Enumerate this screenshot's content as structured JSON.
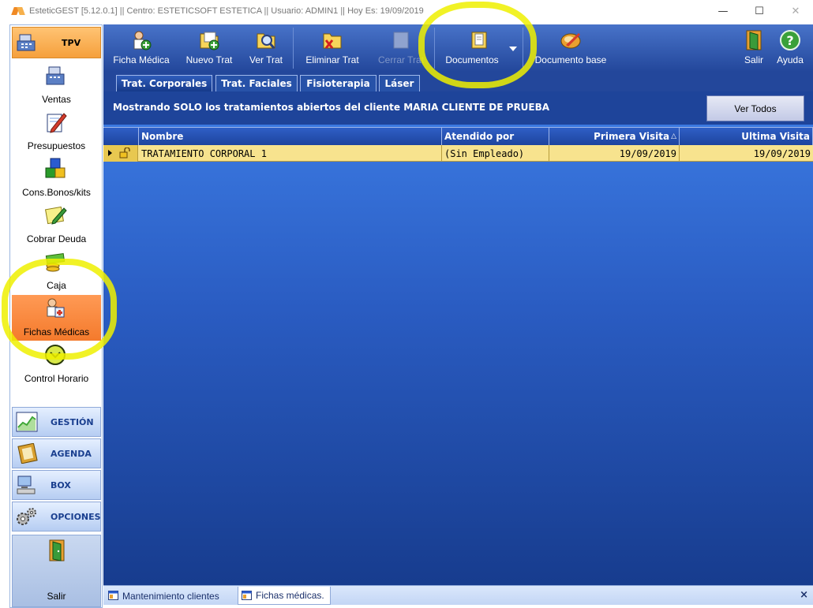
{
  "window": {
    "title": "EsteticGEST [5.12.0.1] || Centro: ESTETICSOFT ESTETICA  || Usuario: ADMIN1 || Hoy Es: 19/09/2019",
    "min_glyph": "—",
    "max_glyph": "☐",
    "close_glyph": "✕"
  },
  "sidebar": {
    "header_label": "TPV",
    "items": [
      {
        "label": "Ventas",
        "icon": "cash-register-icon"
      },
      {
        "label": "Presupuestos",
        "icon": "pencil-document-icon"
      },
      {
        "label": "Cons.Bonos/kits",
        "icon": "blocks-icon"
      },
      {
        "label": "Cobrar Deuda",
        "icon": "note-pencil-icon"
      },
      {
        "label": "Caja",
        "icon": "money-icon"
      },
      {
        "label": "Fichas Médicas",
        "icon": "medical-file-icon",
        "active": true
      },
      {
        "label": "Control Horario",
        "icon": "clock-icon"
      }
    ],
    "sections": [
      {
        "label": "GESTIÓN",
        "icon": "chart-icon"
      },
      {
        "label": "AGENDA",
        "icon": "agenda-icon"
      },
      {
        "label": "BOX",
        "icon": "computer-icon"
      },
      {
        "label": "OPCIONES",
        "icon": "gears-icon"
      }
    ],
    "exit_label": "Salir"
  },
  "toolbar": {
    "buttons": [
      {
        "label": "Ficha Médica",
        "icon": "medical-file-icon",
        "enabled": true
      },
      {
        "label": "Nuevo Trat",
        "icon": "folder-add-icon",
        "enabled": true
      },
      {
        "label": "Ver Trat",
        "icon": "folder-search-icon",
        "enabled": true
      },
      {
        "label": "Eliminar Trat",
        "icon": "folder-delete-icon",
        "enabled": true
      },
      {
        "label": "Cerrar Trat",
        "icon": "folder-close-icon",
        "enabled": false
      },
      {
        "label": "Documentos",
        "icon": "documents-icon",
        "enabled": true
      },
      {
        "label": "Documento base",
        "icon": "document-base-icon",
        "enabled": true
      },
      {
        "label": "Salir",
        "icon": "exit-door-icon",
        "enabled": true
      },
      {
        "label": "Ayuda",
        "icon": "help-icon",
        "enabled": true
      }
    ]
  },
  "tabs": [
    {
      "label": "Trat. Corporales",
      "active": true
    },
    {
      "label": "Trat. Faciales",
      "active": false
    },
    {
      "label": "Fisioterapia",
      "active": false
    },
    {
      "label": "Láser",
      "active": false
    }
  ],
  "info": {
    "message": "Mostrando SOLO los tratamientos abiertos del cliente MARIA CLIENTE DE PRUEBA",
    "view_all_label": "Ver Todos"
  },
  "table": {
    "columns": [
      "Nombre",
      "Atendido por",
      "Primera Visita",
      "Ultima Visita"
    ],
    "sort_indicator": "△",
    "rows": [
      {
        "nombre": "TRATAMIENTO CORPORAL 1",
        "atendido_por": "(Sin Empleado)",
        "primera_visita": "19/09/2019",
        "ultima_visita": "19/09/2019"
      }
    ]
  },
  "bottom_tabs": [
    {
      "label": "Mantenimiento clientes",
      "active": false
    },
    {
      "label": "Fichas médicas.",
      "active": true
    }
  ],
  "bottom_close_glyph": "×",
  "colors": {
    "toolbar_bg": "#23479b",
    "grid_bg": "#2a5cc2",
    "row_highlight": "#f7e38e",
    "active_nav": "#f47a2c",
    "annotation": "#eef000"
  }
}
